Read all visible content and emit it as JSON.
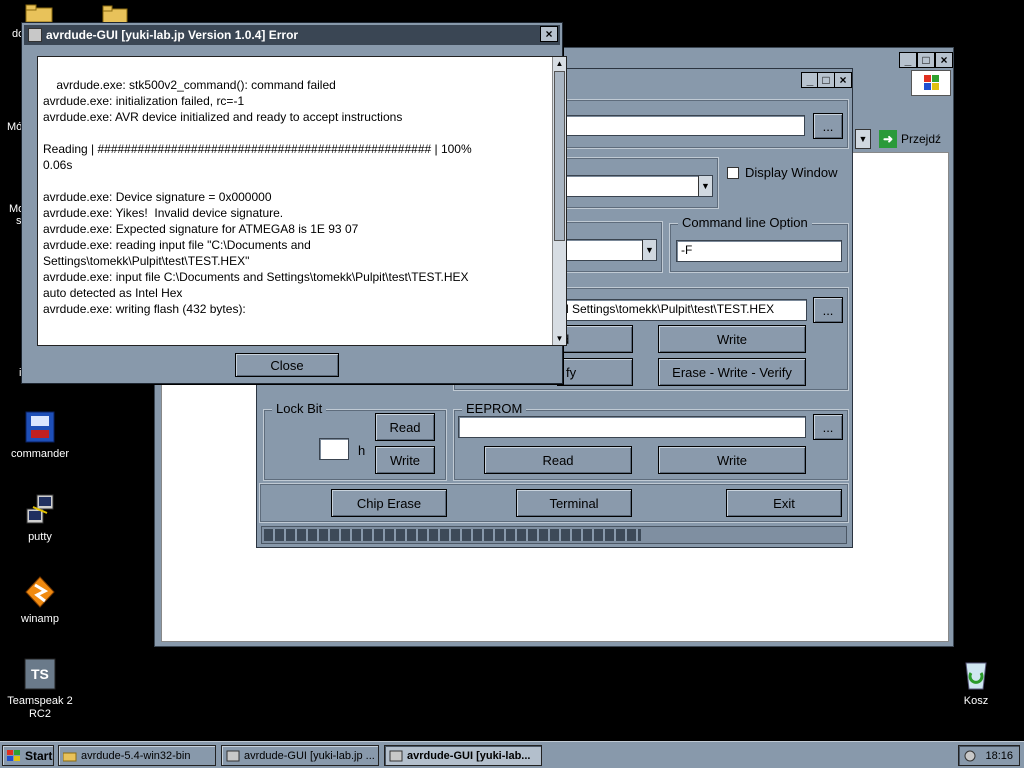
{
  "desktop": {
    "icons": [
      {
        "label": "commander"
      },
      {
        "label": "putty"
      },
      {
        "label": "winamp"
      },
      {
        "label": "Teamspeak 2 RC2"
      },
      {
        "label": "Kosz"
      }
    ],
    "partial_labels": [
      "do",
      "Mó",
      "Mo",
      "s",
      "i"
    ]
  },
  "browser": {
    "go_button": "Przejdź"
  },
  "main": {
    "display_window_label": "Display Window",
    "cmd_group_label": "Command line Option",
    "cmd_value": "-F",
    "flash_path": "d Settings\\tomekk\\Pulpit\\test\\TEST.HEX",
    "flash_read_partial": "d",
    "flash_write": "Write",
    "flash_verify_partial": "fy",
    "flash_ewv": "Erase - Write - Verify",
    "lock_label": "Lock Bit",
    "lock_read": "Read",
    "lock_write": "Write",
    "lock_suffix": "h",
    "eeprom_label": "EEPROM",
    "eeprom_read": "Read",
    "eeprom_write": "Write",
    "browse": "...",
    "chip_erase": "Chip Erase",
    "terminal": "Terminal",
    "exit": "Exit",
    "progress": 0.65
  },
  "dialog": {
    "title": "avrdude-GUI [yuki-lab.jp Version 1.0.4] Error",
    "log": "avrdude.exe: stk500v2_command(): command failed\navrdude.exe: initialization failed, rc=-1\navrdude.exe: AVR device initialized and ready to accept instructions\n\nReading | ################################################## | 100%\n0.06s\n\navrdude.exe: Device signature = 0x000000\navrdude.exe: Yikes!  Invalid device signature.\navrdude.exe: Expected signature for ATMEGA8 is 1E 93 07\navrdude.exe: reading input file \"C:\\Documents and\nSettings\\tomekk\\Pulpit\\test\\TEST.HEX\"\navrdude.exe: input file C:\\Documents and Settings\\tomekk\\Pulpit\\test\\TEST.HEX\nauto detected as Intel Hex\navrdude.exe: writing flash (432 bytes):",
    "close": "Close"
  },
  "taskbar": {
    "start": "Start",
    "tasks": [
      {
        "label": "avrdude-5.4-win32-bin"
      },
      {
        "label": "avrdude-GUI [yuki-lab.jp ..."
      },
      {
        "label": "avrdude-GUI [yuki-lab..."
      }
    ],
    "clock": "18:16"
  }
}
